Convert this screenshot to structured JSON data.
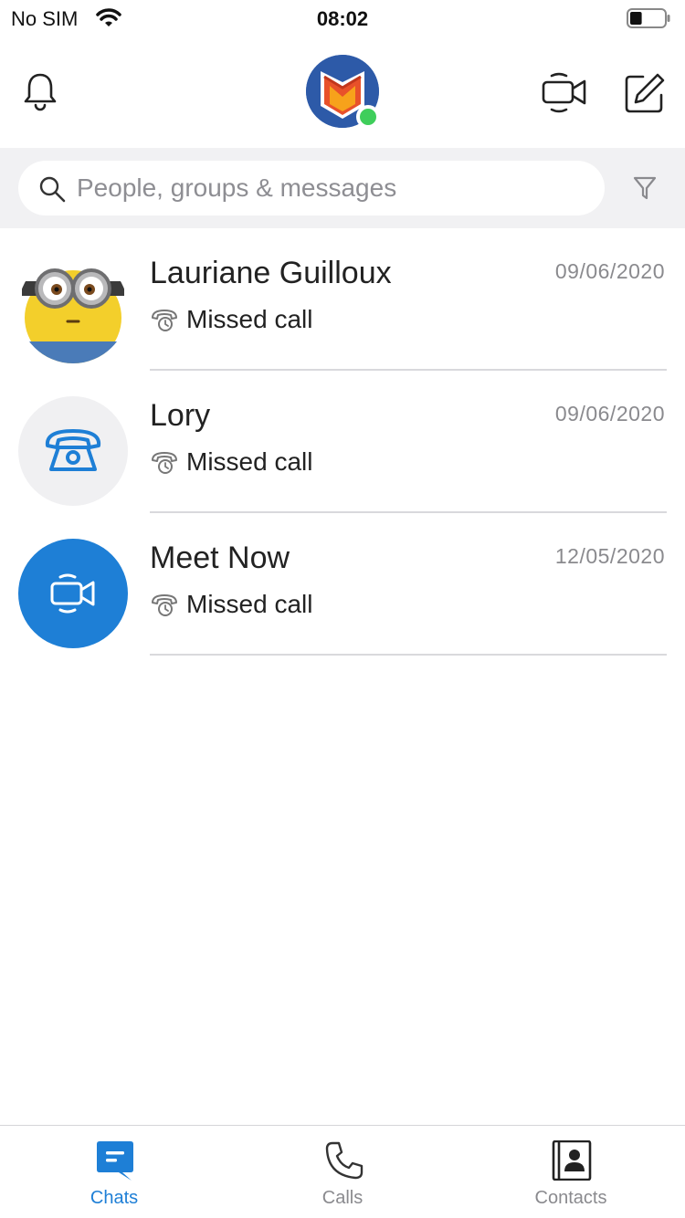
{
  "status_bar": {
    "carrier": "No SIM",
    "time": "08:02",
    "battery_level": 0.35
  },
  "header": {
    "bell_icon": "bell-icon",
    "profile_presence": "online",
    "video_icon": "video-camera-icon",
    "compose_icon": "compose-icon"
  },
  "search": {
    "placeholder": "People, groups & messages",
    "value": "",
    "filter_icon": "filter-icon"
  },
  "chats": [
    {
      "name": "Lauriane Guilloux",
      "date": "09/06/2020",
      "preview": "Missed call",
      "avatar": "minion-photo"
    },
    {
      "name": "Lory",
      "date": "09/06/2020",
      "preview": "Missed call",
      "avatar": "phone-icon"
    },
    {
      "name": "Meet Now",
      "date": "12/05/2020",
      "preview": "Missed call",
      "avatar": "video-icon"
    }
  ],
  "tabs": [
    {
      "label": "Chats",
      "icon": "chat-icon",
      "active": true
    },
    {
      "label": "Calls",
      "icon": "phone-icon",
      "active": false
    },
    {
      "label": "Contacts",
      "icon": "contacts-icon",
      "active": false
    }
  ],
  "colors": {
    "accent": "#1e7fd6",
    "presence": "#3fce5b",
    "search_bg": "#f1f1f3",
    "muted_text": "#8a8a8e"
  }
}
